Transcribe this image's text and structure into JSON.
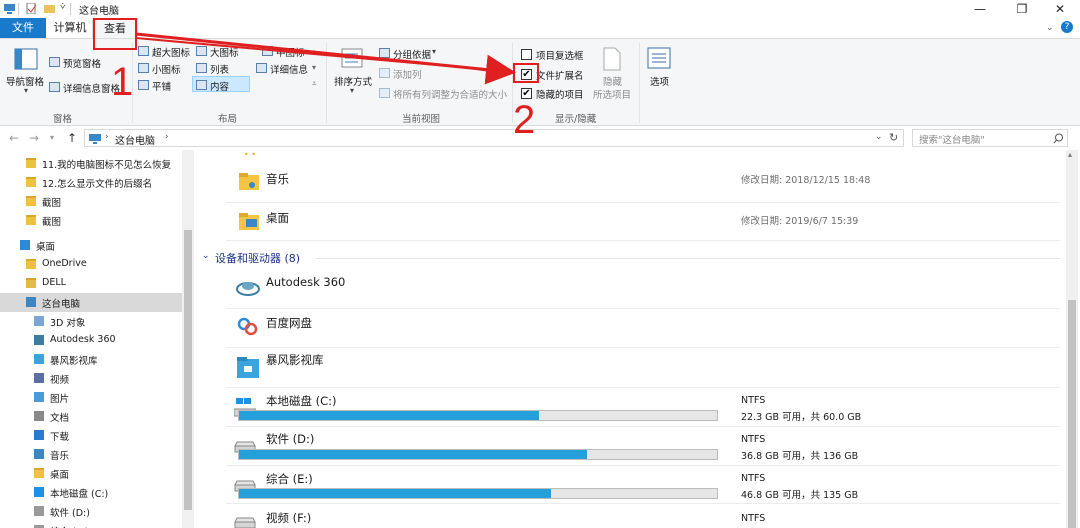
{
  "title_bar": {
    "title": "这台电脑",
    "controls": [
      "—",
      "❐",
      "✕"
    ]
  },
  "ribbon_tabs": [
    {
      "label": "文件"
    },
    {
      "label": "计算机"
    },
    {
      "label": "查看"
    }
  ],
  "ribbon": {
    "pane": {
      "nav_pane_label": "导航窗格",
      "preview_label": "预览窗格",
      "details_label": "详细信息窗格",
      "group_label": "窗格"
    },
    "layout": {
      "items": [
        "超大图标",
        "大图标",
        "中图标",
        "小图标",
        "列表",
        "详细信息",
        "平铺",
        "内容"
      ],
      "group_label": "布局"
    },
    "current_view": {
      "sort_label": "排序方式",
      "group_by_label": "分组依据",
      "add_col_label": "添加列",
      "fit_cols_label": "将所有列调整为合适的大小",
      "group_label": "当前视图"
    },
    "show_hide": {
      "item_checkbox_label": "项目复选框",
      "file_ext_label": "文件扩展名",
      "hidden_items_label": "隐藏的项目",
      "hide_selected_label": "隐藏",
      "hide_selected_label2": "所选项目",
      "group_label": "显示/隐藏"
    },
    "options_label": "选项"
  },
  "address": {
    "path": "这台电脑",
    "search_placeholder": "搜索\"这台电脑\""
  },
  "nav_pane": {
    "items": [
      {
        "label": "11.我的电脑图标不见怎么恢复"
      },
      {
        "label": "12.怎么显示文件的后缀名"
      },
      {
        "label": "截图"
      },
      {
        "label": "截图"
      },
      {
        "label": "桌面"
      },
      {
        "label": "OneDrive"
      },
      {
        "label": "DELL"
      },
      {
        "label": "这台电脑"
      },
      {
        "label": "3D 对象"
      },
      {
        "label": "Autodesk 360"
      },
      {
        "label": "暴风影视库"
      },
      {
        "label": "视频"
      },
      {
        "label": "图片"
      },
      {
        "label": "文档"
      },
      {
        "label": "下载"
      },
      {
        "label": "音乐"
      },
      {
        "label": "桌面"
      },
      {
        "label": "本地磁盘 (C:)"
      },
      {
        "label": "软件 (D:)"
      },
      {
        "label": "综合 (E:)"
      }
    ]
  },
  "content": {
    "folders": [
      {
        "name": "音乐",
        "meta": "修改日期: 2018/12/15 18:48"
      },
      {
        "name": "桌面",
        "meta": "修改日期: 2019/6/7 15:39"
      }
    ],
    "devices_header": "设备和驱动器 (8)",
    "devices": [
      {
        "name": "Autodesk 360"
      },
      {
        "name": "百度网盘"
      },
      {
        "name": "暴风影视库"
      }
    ],
    "drives": [
      {
        "name": "本地磁盘 (C:)",
        "fs": "NTFS",
        "free": "22.3 GB 可用，共 60.0 GB",
        "used_fraction": 0.628
      },
      {
        "name": "软件 (D:)",
        "fs": "NTFS",
        "free": "36.8 GB 可用，共 136 GB",
        "used_fraction": 0.729
      },
      {
        "name": "综合 (E:)",
        "fs": "NTFS",
        "free": "46.8 GB 可用，共 135 GB",
        "used_fraction": 0.653
      },
      {
        "name": "视频 (F:)",
        "fs": "NTFS"
      }
    ]
  },
  "annotations": {
    "step1": "1",
    "step2": "2"
  },
  "colors": {
    "accent": "#1979ca",
    "annotation": "#e02020",
    "drive_bar": "#26a0da"
  }
}
